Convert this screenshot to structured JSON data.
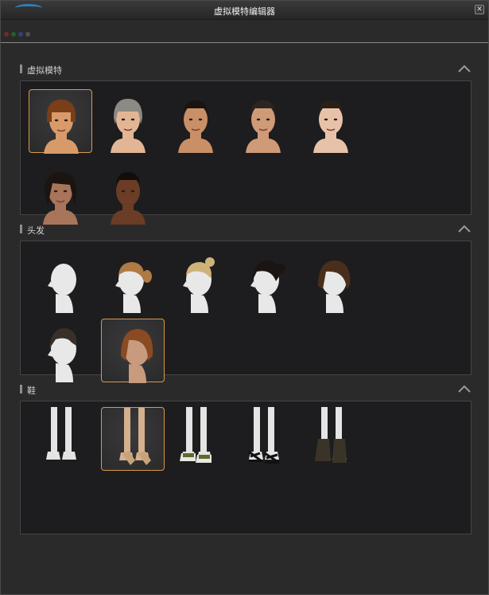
{
  "window": {
    "title": "虚拟模特编辑器",
    "close_glyph": "✕"
  },
  "colors": {
    "accent": "#d79a4a",
    "logo": "#2d7fb7"
  },
  "sections": [
    {
      "title": "虚拟模特",
      "collapse_icon": "chevron-up-icon",
      "items": [
        {
          "name": "model-female-brown-hair",
          "selected": true
        },
        {
          "name": "model-female-gray-hair",
          "selected": false
        },
        {
          "name": "model-male-asian",
          "selected": false
        },
        {
          "name": "model-male-caucasian",
          "selected": false
        },
        {
          "name": "model-child",
          "selected": false
        },
        {
          "name": "model-female-dark-hair",
          "selected": false
        },
        {
          "name": "model-male-african",
          "selected": false
        }
      ]
    },
    {
      "title": "头发",
      "collapse_icon": "chevron-up-icon",
      "items": [
        {
          "name": "hair-bald",
          "selected": false
        },
        {
          "name": "hair-brown-ponytail",
          "selected": false
        },
        {
          "name": "hair-blonde-bun",
          "selected": false
        },
        {
          "name": "hair-black-bun",
          "selected": false
        },
        {
          "name": "hair-brown-bob",
          "selected": false
        },
        {
          "name": "hair-dark-short",
          "selected": false
        },
        {
          "name": "hair-auburn-bob",
          "selected": true
        }
      ]
    },
    {
      "title": "鞋",
      "collapse_icon": "chevron-up-icon",
      "items": [
        {
          "name": "shoes-barefoot",
          "selected": false
        },
        {
          "name": "shoes-beige-heels",
          "selected": true
        },
        {
          "name": "shoes-green-sneakers",
          "selected": false
        },
        {
          "name": "shoes-black-strappy-heels",
          "selected": false
        },
        {
          "name": "shoes-dark-ankle-boots",
          "selected": false
        }
      ]
    }
  ]
}
